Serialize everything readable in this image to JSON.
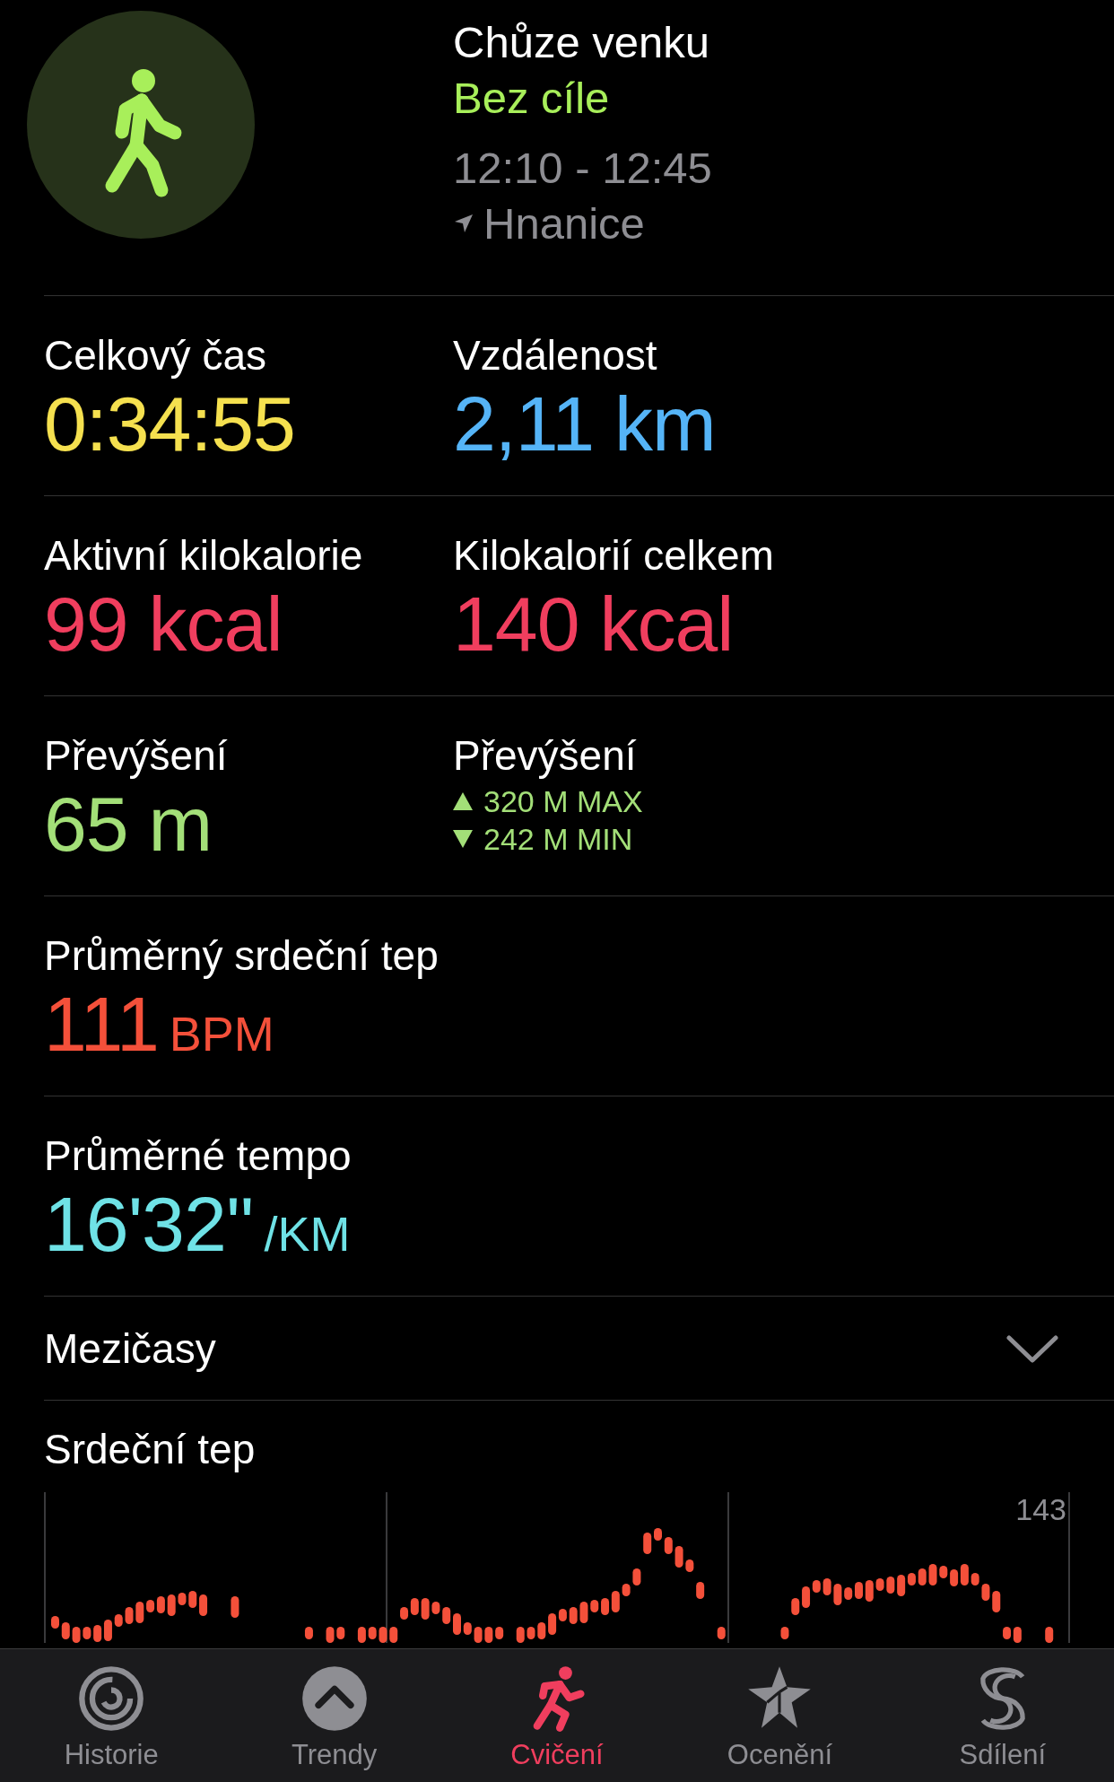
{
  "workout": {
    "title": "Chůze venku",
    "goal": "Bez cíle",
    "time_range": "12:10 - 12:45",
    "location": "Hnanice"
  },
  "metric_rows": [
    {
      "cells": [
        {
          "label": "Celkový čas",
          "value": "0:34:55",
          "color": "#f5e04f"
        },
        {
          "label": "Vzdálenost",
          "value": "2,11 km",
          "color": "#55b4f7"
        }
      ]
    },
    {
      "cells": [
        {
          "label": "Aktivní kilokalorie",
          "value": "99 kcal",
          "color": "#f03e5e"
        },
        {
          "label": "Kilokalorií celkem",
          "value": "140 kcal",
          "color": "#f03e5e"
        }
      ]
    },
    {
      "cells": [
        {
          "label": "Převýšení",
          "value": "65 m",
          "color": "#a3df78"
        },
        {
          "label": "Převýšení",
          "color": "#a3df78",
          "range": [
            {
              "text": "320 M MAX"
            },
            {
              "text": "242 M MIN"
            }
          ]
        }
      ]
    },
    {
      "cells": [
        {
          "label": "Průměrný srdeční tep",
          "value": "111",
          "unit": "BPM",
          "color": "#f4503a"
        }
      ]
    },
    {
      "cells": [
        {
          "label": "Průměrné tempo",
          "value": "16'32''",
          "unit": "/KM",
          "color": "#6fe2e6"
        }
      ]
    }
  ],
  "splits": {
    "label": "Mezičasy",
    "expanded": false
  },
  "heart_rate": {
    "label": "Srdeční tep",
    "max_label": "143"
  },
  "tab_bar": [
    {
      "label": "Historie",
      "selected": false
    },
    {
      "label": "Trendy",
      "selected": false
    },
    {
      "label": "Cvičení",
      "selected": true
    },
    {
      "label": "Ocenění",
      "selected": false
    },
    {
      "label": "Sdílení",
      "selected": false
    }
  ]
}
